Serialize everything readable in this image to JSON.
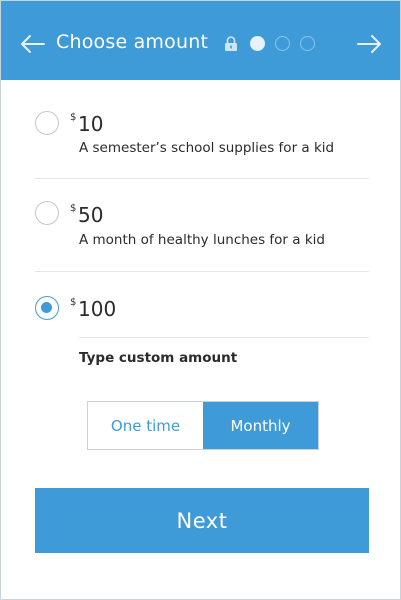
{
  "header": {
    "title": "Choose amount",
    "steps": {
      "total": 3,
      "current": 1
    },
    "colors": {
      "background": "#3f9bd8",
      "text": "#ffffff"
    },
    "icons": {
      "back": "arrow-left-icon",
      "forward": "arrow-right-icon",
      "secure": "lock-icon"
    }
  },
  "options": [
    {
      "currency": "$",
      "amount": "10",
      "description": "A semester’s school supplies for a kid",
      "selected": false
    },
    {
      "currency": "$",
      "amount": "50",
      "description": "A month of healthy lunches for a kid",
      "selected": false
    },
    {
      "currency": "$",
      "amount": "100",
      "description": "",
      "selected": true
    }
  ],
  "custom_amount": {
    "label": "Type custom amount"
  },
  "frequency": {
    "options": [
      "One time",
      "Monthly"
    ],
    "selected": "Monthly"
  },
  "next_button": {
    "label": "Next"
  },
  "accent_color": "#3f9bd8"
}
